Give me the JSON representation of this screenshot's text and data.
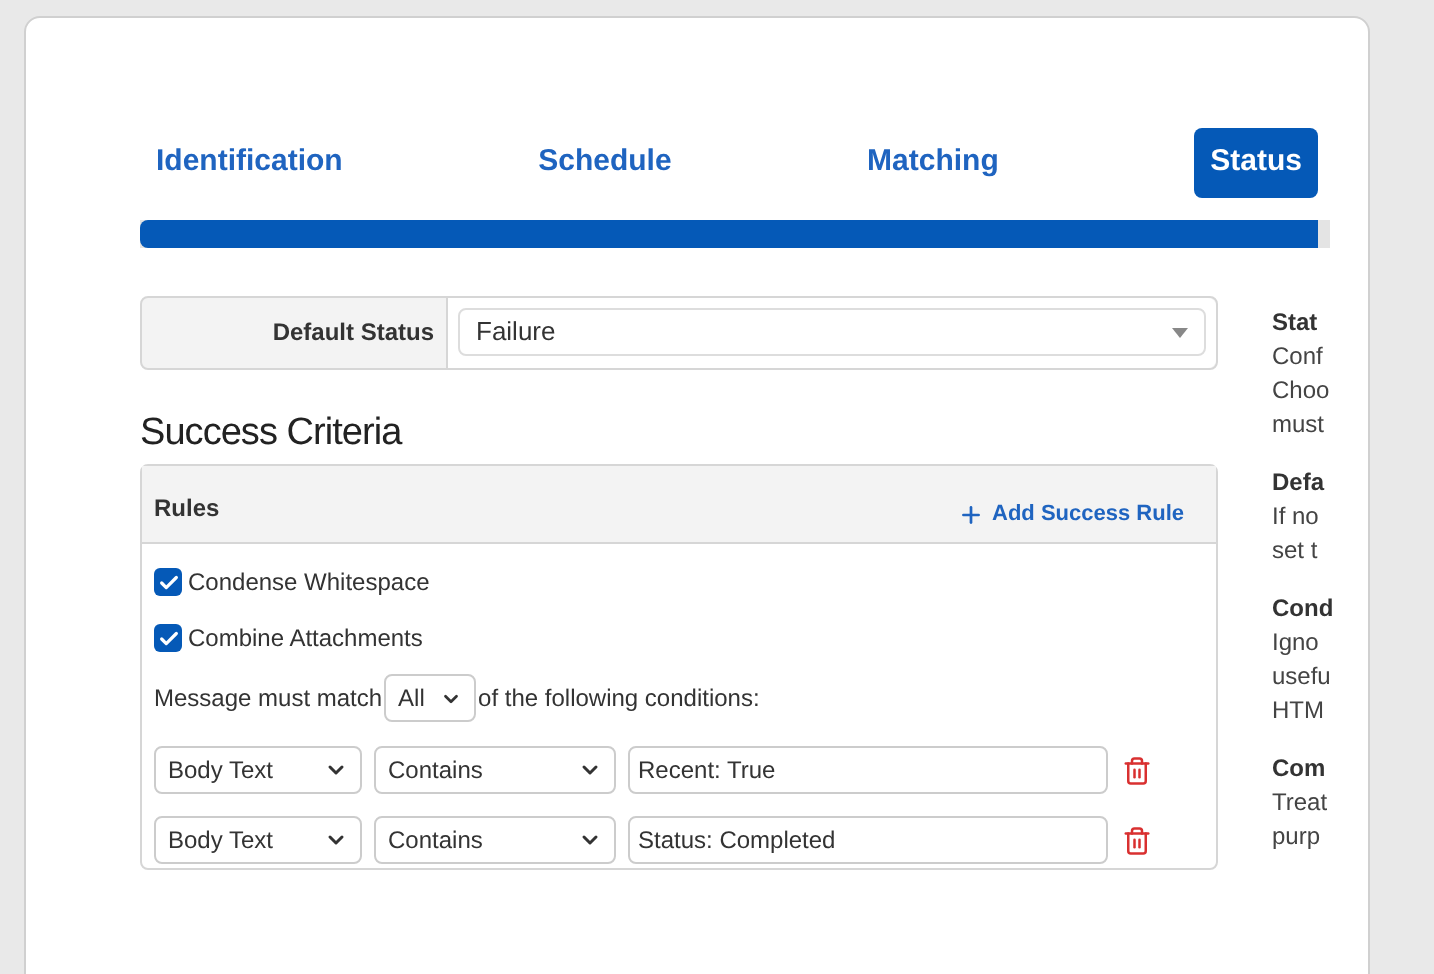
{
  "tabs": [
    {
      "label": "Identification",
      "selected": false
    },
    {
      "label": "Schedule",
      "selected": false
    },
    {
      "label": "Matching",
      "selected": false
    },
    {
      "label": "Status",
      "selected": true
    }
  ],
  "progress": {
    "level": 0.99
  },
  "default_status": {
    "label": "Default Status",
    "value": "Failure"
  },
  "success_criteria": {
    "title": "Success Criteria",
    "rules_title": "Rules",
    "add_button": "Add Success Rule",
    "options": [
      {
        "label": "Condense Whitespace",
        "checked": true
      },
      {
        "label": "Combine Attachments",
        "checked": true
      }
    ],
    "match_prefix": "Message must match",
    "match_value": "All",
    "match_suffix": "of the following conditions:",
    "conditions": [
      {
        "field": "Body Text",
        "operator": "Contains",
        "value": "Recent: True"
      },
      {
        "field": "Body Text",
        "operator": "Contains",
        "value": "Status: Completed"
      }
    ]
  },
  "help": [
    {
      "title": "Stat",
      "lines": [
        "Conf",
        "Choo",
        "must"
      ]
    },
    {
      "title": "Defa",
      "lines": [
        "If no",
        "set t"
      ]
    },
    {
      "title": "Cond",
      "lines": [
        "Igno",
        "usefu",
        "HTM"
      ]
    },
    {
      "title": "Com",
      "lines": [
        "Treat",
        "purp"
      ]
    }
  ]
}
